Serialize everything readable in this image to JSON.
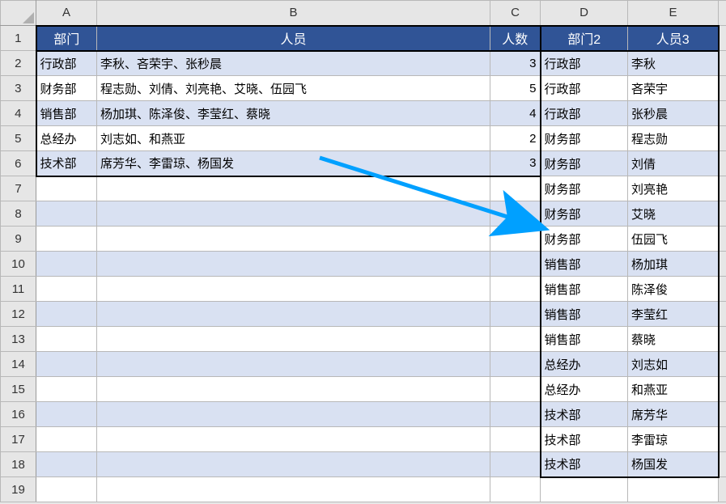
{
  "columns": {
    "A": "A",
    "B": "B",
    "C": "C",
    "D": "D",
    "E": "E"
  },
  "rows": [
    "1",
    "2",
    "3",
    "4",
    "5",
    "6",
    "7",
    "8",
    "9",
    "10",
    "11",
    "12",
    "13",
    "14",
    "15",
    "16",
    "17",
    "18",
    "19"
  ],
  "headers": {
    "dept": "部门",
    "people": "人员",
    "count": "人数",
    "dept2": "部门2",
    "people3": "人员3"
  },
  "rowsAC": [
    {
      "dept": "行政部",
      "people": "李秋、吝荣宇、张秒晨",
      "count": 3
    },
    {
      "dept": "财务部",
      "people": "程志勋、刘倩、刘亮艳、艾晓、伍园飞",
      "count": 5
    },
    {
      "dept": "销售部",
      "people": "杨加琪、陈泽俊、李莹红、蔡晓",
      "count": 4
    },
    {
      "dept": "总经办",
      "people": "刘志如、和燕亚",
      "count": 2
    },
    {
      "dept": "技术部",
      "people": "席芳华、李雷琼、杨国发",
      "count": 3
    }
  ],
  "rowsDE": [
    {
      "dept2": "行政部",
      "people3": "李秋"
    },
    {
      "dept2": "行政部",
      "people3": "吝荣宇"
    },
    {
      "dept2": "行政部",
      "people3": "张秒晨"
    },
    {
      "dept2": "财务部",
      "people3": "程志勋"
    },
    {
      "dept2": "财务部",
      "people3": "刘倩"
    },
    {
      "dept2": "财务部",
      "people3": "刘亮艳"
    },
    {
      "dept2": "财务部",
      "people3": "艾晓"
    },
    {
      "dept2": "财务部",
      "people3": "伍园飞"
    },
    {
      "dept2": "销售部",
      "people3": "杨加琪"
    },
    {
      "dept2": "销售部",
      "people3": "陈泽俊"
    },
    {
      "dept2": "销售部",
      "people3": "李莹红"
    },
    {
      "dept2": "销售部",
      "people3": "蔡晓"
    },
    {
      "dept2": "总经办",
      "people3": "刘志如"
    },
    {
      "dept2": "总经办",
      "people3": "和燕亚"
    },
    {
      "dept2": "技术部",
      "people3": "席芳华"
    },
    {
      "dept2": "技术部",
      "people3": "李雷琼"
    },
    {
      "dept2": "技术部",
      "people3": "杨国发"
    }
  ],
  "arrow": {
    "color": "#00a0ff"
  }
}
